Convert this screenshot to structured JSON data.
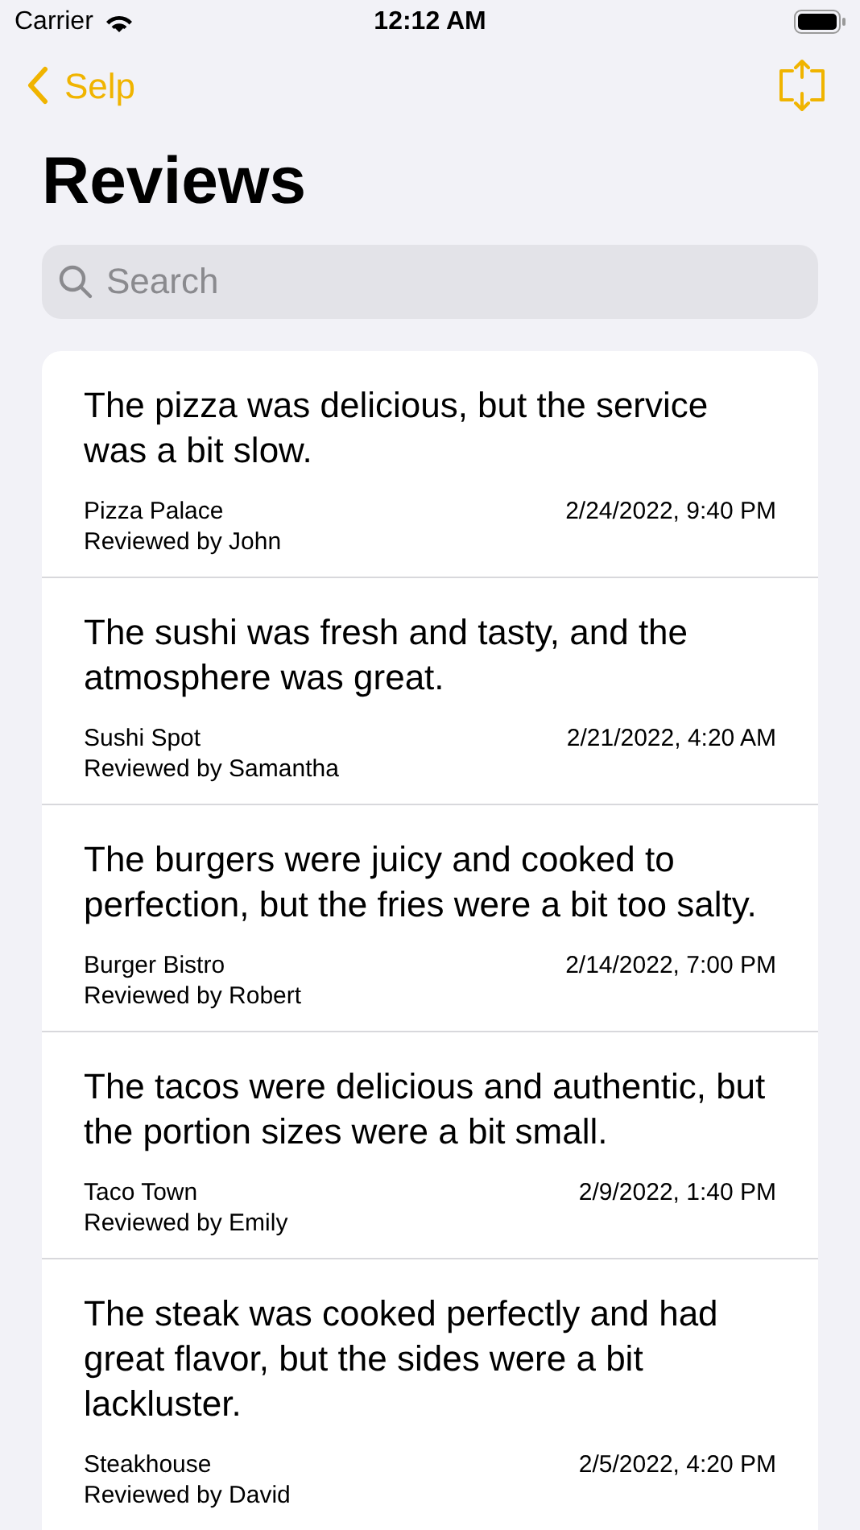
{
  "status_bar": {
    "carrier": "Carrier",
    "time": "12:12 AM"
  },
  "nav": {
    "back_label": "Selp"
  },
  "title": "Reviews",
  "search": {
    "placeholder": "Search"
  },
  "reviews": [
    {
      "text": "The pizza was delicious, but the service was a bit slow.",
      "restaurant": "Pizza Palace",
      "reviewer": "Reviewed by John",
      "date": "2/24/2022, 9:40 PM"
    },
    {
      "text": "The sushi was fresh and tasty, and the atmosphere was great.",
      "restaurant": "Sushi Spot",
      "reviewer": "Reviewed by Samantha",
      "date": "2/21/2022, 4:20 AM"
    },
    {
      "text": "The burgers were juicy and cooked to perfection, but the fries were a bit too salty.",
      "restaurant": "Burger Bistro",
      "reviewer": "Reviewed by Robert",
      "date": "2/14/2022, 7:00 PM"
    },
    {
      "text": "The tacos were delicious and authentic, but the portion sizes were a bit small.",
      "restaurant": "Taco Town",
      "reviewer": "Reviewed by Emily",
      "date": "2/9/2022, 1:40 PM"
    },
    {
      "text": "The steak was cooked perfectly and had great flavor, but the sides were a bit lackluster.",
      "restaurant": "Steakhouse",
      "reviewer": "Reviewed by David",
      "date": "2/5/2022, 4:20 PM"
    }
  ]
}
